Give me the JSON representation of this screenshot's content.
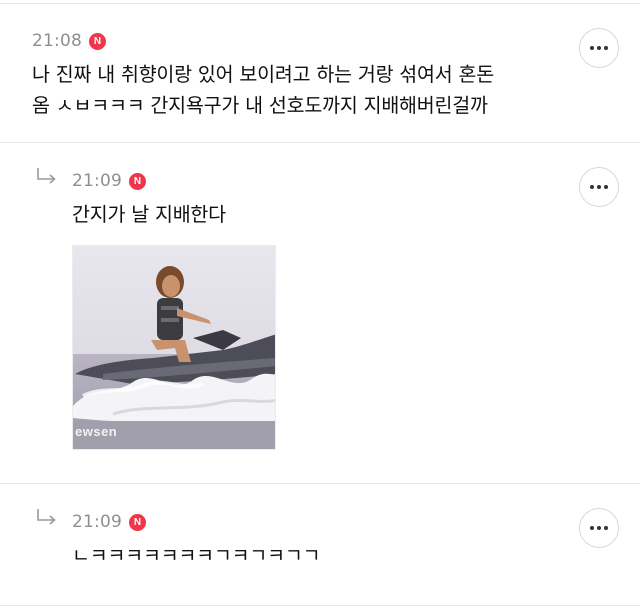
{
  "comments": [
    {
      "time": "21:08",
      "badge": "N",
      "lines": [
        "나 진짜 내 취향이랑 있어 보이려고 하는 거랑 섞여서 혼돈",
        "옴 ㅅㅂㅋㅋㅋ 간지욕구가 내 선호도까지 지배해버린걸까"
      ]
    },
    {
      "time": "21:09",
      "badge": "N",
      "text": "간지가 날 지배한다",
      "image": {
        "watermark": "ewsen",
        "description_icon": "jet-ski-photo"
      }
    },
    {
      "time": "21:09",
      "badge": "N",
      "text": "ㄴㅋㅋㅋㅋㅋㅋㅋㄱㅋㄱㅋㄱㄱ"
    }
  ],
  "colors": {
    "badge": "#f0364b",
    "time": "#8f8f8f",
    "divider": "#e6e6e6"
  }
}
